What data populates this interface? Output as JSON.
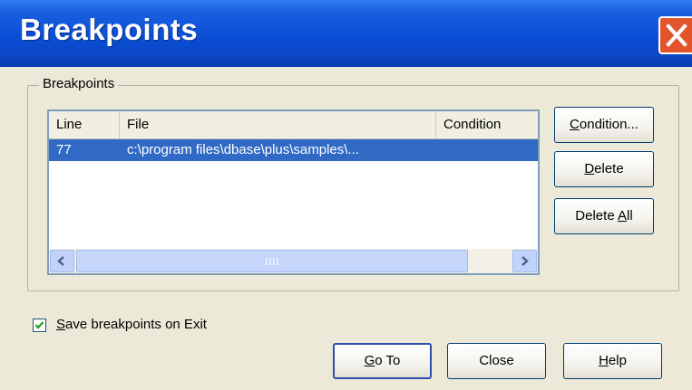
{
  "dialog": {
    "title": "Breakpoints",
    "group_label": "Breakpoints"
  },
  "list": {
    "columns": [
      "Line",
      "File",
      "Condition"
    ],
    "rows": [
      {
        "line": "77",
        "file": "c:\\program files\\dbase\\plus\\samples\\...",
        "condition": ""
      }
    ]
  },
  "side_buttons": {
    "condition": {
      "pre": "",
      "key": "C",
      "post": "ondition..."
    },
    "delete": {
      "pre": "",
      "key": "D",
      "post": "elete"
    },
    "delete_all": {
      "pre": "Delete ",
      "key": "A",
      "post": "ll"
    }
  },
  "checkbox": {
    "checked": true,
    "pre": "",
    "key": "S",
    "post": "ave breakpoints on Exit"
  },
  "bottom_buttons": {
    "goto": {
      "pre": "",
      "key": "G",
      "post": "o To"
    },
    "close": "Close",
    "help": {
      "pre": "",
      "key": "H",
      "post": "elp"
    }
  },
  "colors": {
    "titlebar": "#0a4fd6",
    "selection": "#316ac5",
    "dialog_bg": "#ece9d8",
    "close_button": "#e2552a"
  },
  "icons": {
    "close": "close-x-icon",
    "scroll_left": "arrow-left-icon",
    "scroll_right": "arrow-right-icon",
    "check": "checkmark-icon"
  }
}
